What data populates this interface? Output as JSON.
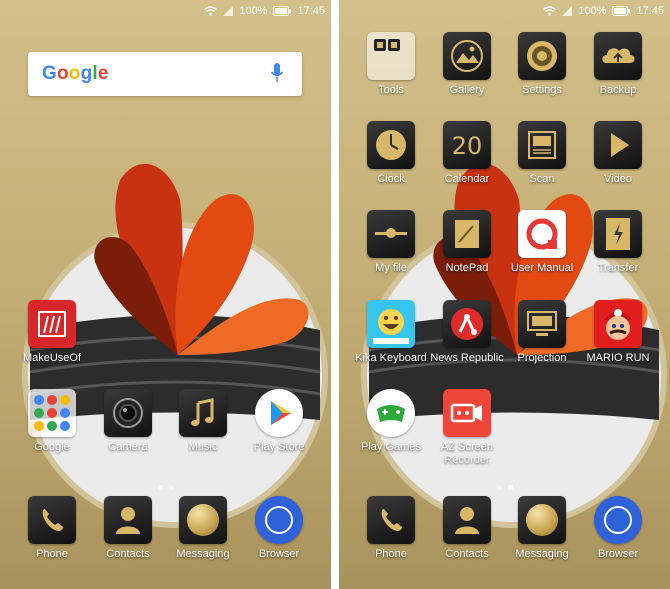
{
  "status_bar": {
    "battery": "100%",
    "time": "17:45"
  },
  "left_screen": {
    "search": {
      "logo": "Google"
    },
    "apps": [
      {
        "label": "MakeUseOf",
        "icon": "makeuseof-icon"
      },
      {
        "label": "Google",
        "icon": "google-folder-icon"
      },
      {
        "label": "Camera",
        "icon": "camera-icon"
      },
      {
        "label": "Music",
        "icon": "music-icon"
      },
      {
        "label": "Play Store",
        "icon": "play-store-icon"
      }
    ],
    "dock": [
      {
        "label": "Phone",
        "icon": "phone-icon"
      },
      {
        "label": "Contacts",
        "icon": "contacts-icon"
      },
      {
        "label": "Messaging",
        "icon": "messaging-icon"
      },
      {
        "label": "Browser",
        "icon": "browser-icon"
      }
    ]
  },
  "right_screen": {
    "apps": [
      {
        "label": "Tools",
        "icon": "tools-folder-icon"
      },
      {
        "label": "Gallery",
        "icon": "gallery-icon"
      },
      {
        "label": "Settings",
        "icon": "settings-icon"
      },
      {
        "label": "Backup",
        "icon": "backup-icon"
      },
      {
        "label": "Clock",
        "icon": "clock-icon"
      },
      {
        "label": "Calendar",
        "icon": "calendar-icon",
        "date": "20"
      },
      {
        "label": "Scan",
        "icon": "scan-icon"
      },
      {
        "label": "Video",
        "icon": "video-icon"
      },
      {
        "label": "My file",
        "icon": "my-file-icon"
      },
      {
        "label": "NotePad",
        "icon": "notepad-icon"
      },
      {
        "label": "User Manual",
        "icon": "user-manual-icon"
      },
      {
        "label": "Transfer",
        "icon": "transfer-icon"
      },
      {
        "label": "Kika Keyboard",
        "icon": "kika-keyboard-icon"
      },
      {
        "label": "News Republic",
        "icon": "news-republic-icon"
      },
      {
        "label": "Projection",
        "icon": "projection-icon"
      },
      {
        "label": "MARIO RUN",
        "icon": "mario-run-icon"
      },
      {
        "label": "Play Games",
        "icon": "play-games-icon"
      },
      {
        "label": "AZ Screen Recorder",
        "icon": "az-screen-recorder-icon"
      }
    ],
    "dock": [
      {
        "label": "Phone",
        "icon": "phone-icon"
      },
      {
        "label": "Contacts",
        "icon": "contacts-icon"
      },
      {
        "label": "Messaging",
        "icon": "messaging-icon"
      },
      {
        "label": "Browser",
        "icon": "browser-icon"
      }
    ]
  },
  "colors": {
    "wallpaper_gold": "#c6b178",
    "makeuseof_red": "#d8262b",
    "browser_blue": "#2f62d8",
    "petal_orange": "#e24a12"
  }
}
